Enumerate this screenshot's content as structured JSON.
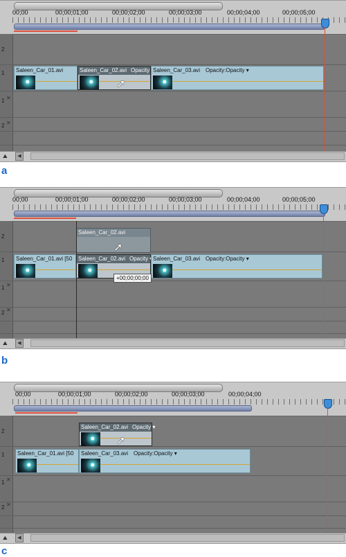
{
  "panels": [
    {
      "id": "a",
      "label": "a",
      "time_labels": [
        "00;00",
        "00;00;01;00",
        "00;00;02;00",
        "00;00;03;00",
        "00;00;04;00",
        "00;00;05;00"
      ],
      "tracks": [
        "2",
        "1",
        "1",
        "2"
      ],
      "clips": {
        "clip1": "Saleen_Car_01.avi",
        "clip2": "Saleen_Car_02.avi",
        "clip2_opacity": "Opacity ▾",
        "clip3": "Saleen_Car_03.avi",
        "clip3_opacity": "Opacity:Opacity ▾"
      }
    },
    {
      "id": "b",
      "label": "b",
      "time_labels": [
        "00;00",
        "00;00;01;00",
        "00;00;02;00",
        "00;00;03;00",
        "00;00;04;00",
        "00;00;05;00"
      ],
      "tracks": [
        "2",
        "1",
        "1",
        "2"
      ],
      "clips": {
        "ghost": "Saleen_Car_02.avi",
        "clip1": "Saleen_Car_01.avi [50",
        "clip2": "Saleen_Car_02.avi",
        "clip2_opacity": "Opacity ▾",
        "clip3": "Saleen_Car_03.avi",
        "clip3_opacity": "Opacity:Opacity ▾",
        "tooltip": "+00;00;00;00"
      }
    },
    {
      "id": "c",
      "label": "c",
      "time_labels": [
        "00;00",
        "00;00;01;00",
        "00;00;02;00",
        "00;00;03;00",
        "00;00;04;00"
      ],
      "tracks": [
        "2",
        "1",
        "1",
        "2"
      ],
      "clips": {
        "clip2": "Saleen_Car_02.avi",
        "clip2_opacity": "Opacity ▾",
        "clip1": "Saleen_Car_01.avi [50",
        "clip3": "Saleen_Car_03.avi",
        "clip3_opacity": "Opacity:Opacity ▾"
      }
    }
  ]
}
